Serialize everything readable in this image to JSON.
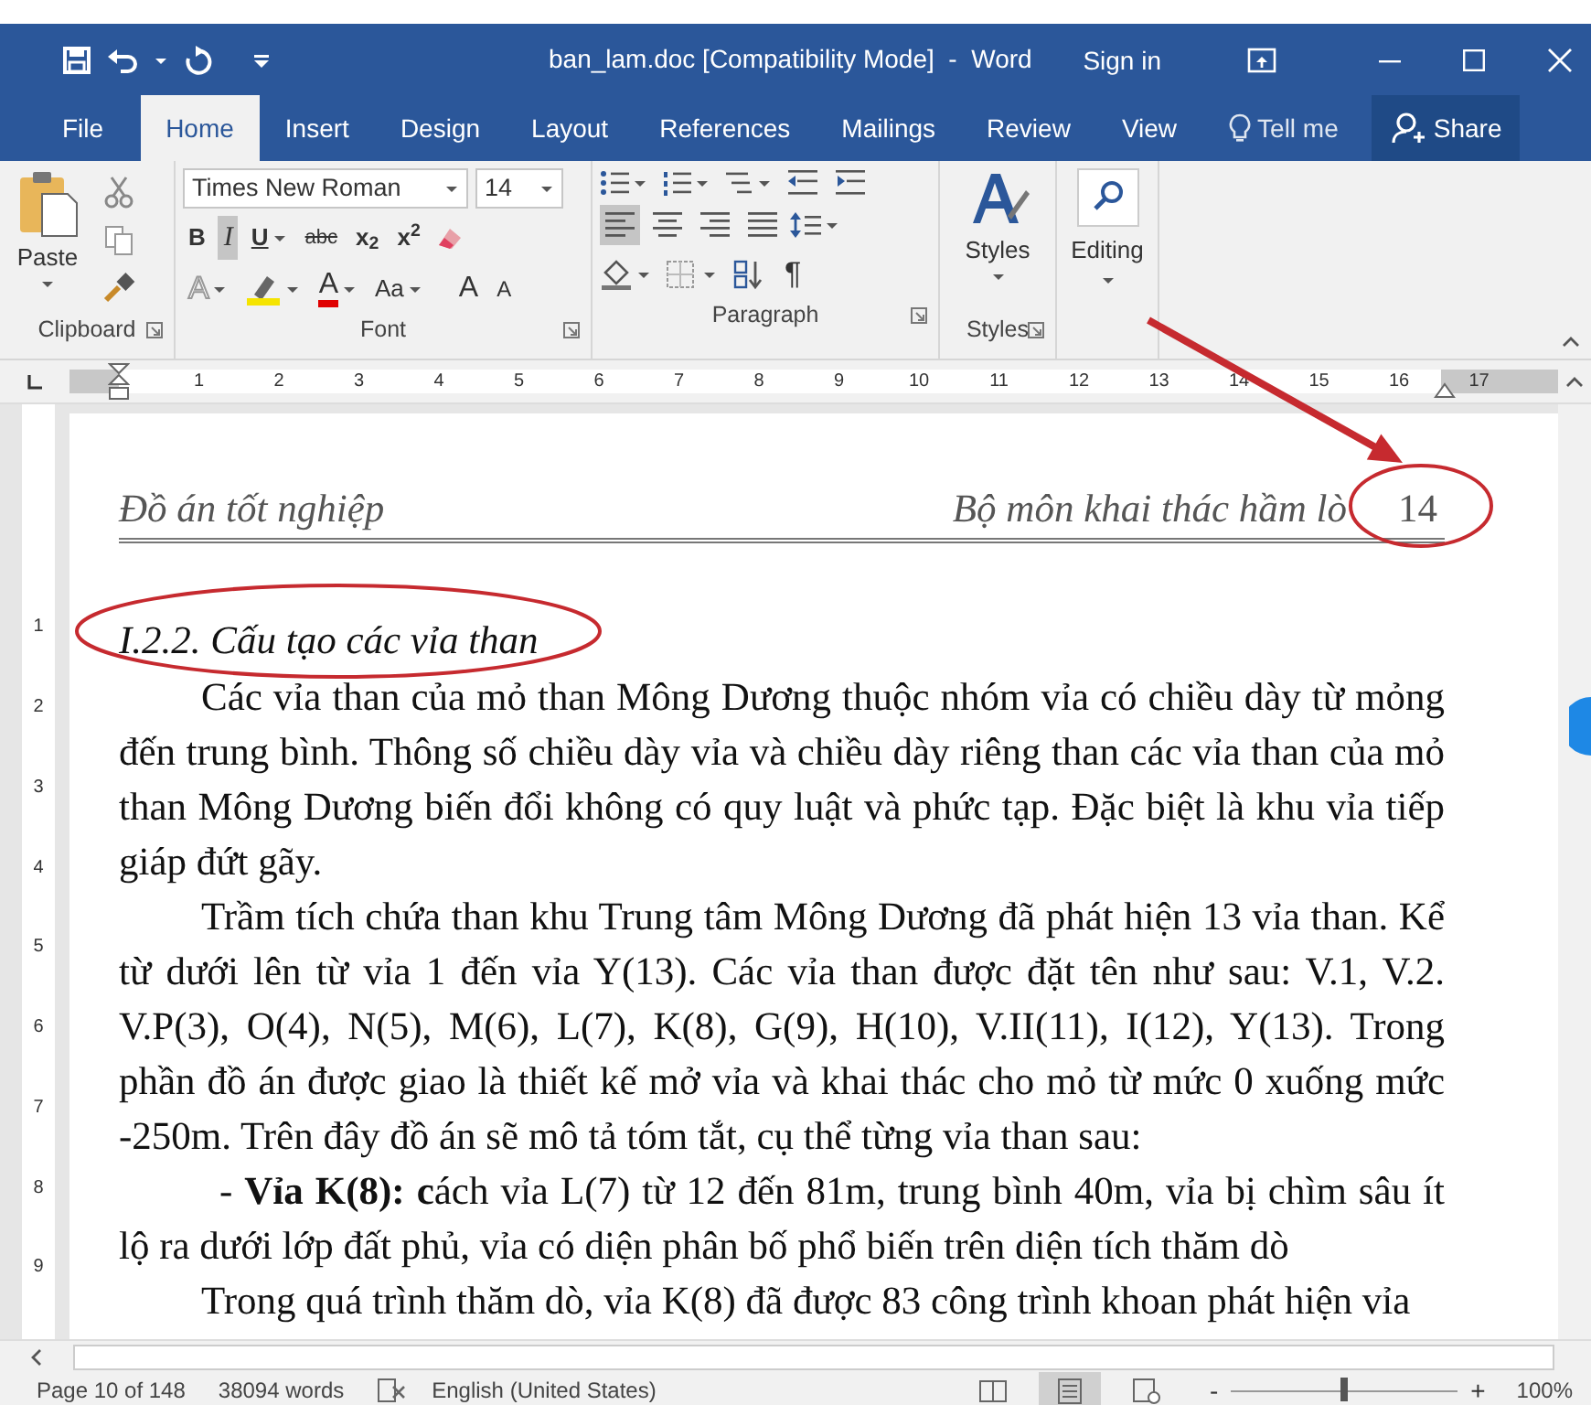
{
  "window": {
    "title": "ban_lam.doc [Compatibility Mode]  -  Word",
    "sign_in": "Sign in"
  },
  "tabs": [
    {
      "label": "File",
      "selected": false
    },
    {
      "label": "Home",
      "selected": true
    },
    {
      "label": "Insert",
      "selected": false
    },
    {
      "label": "Design",
      "selected": false
    },
    {
      "label": "Layout",
      "selected": false
    },
    {
      "label": "References",
      "selected": false
    },
    {
      "label": "Mailings",
      "selected": false
    },
    {
      "label": "Review",
      "selected": false
    },
    {
      "label": "View",
      "selected": false
    }
  ],
  "tell_me": "Tell me",
  "share": "Share",
  "clipboard": {
    "paste": "Paste",
    "label": "Clipboard"
  },
  "font": {
    "name": "Times New Roman",
    "size": "14",
    "styles": [
      {
        "label": "B",
        "kind": "bold",
        "on": false
      },
      {
        "label": "I",
        "kind": "italic",
        "on": true
      },
      {
        "label": "U",
        "kind": "underline",
        "on": false
      },
      {
        "label": "abc",
        "kind": "strike",
        "on": false
      },
      {
        "label": "x$_{2}$",
        "kind": "subscript",
        "on": false
      },
      {
        "label": "x$^{2}$",
        "kind": "superscript",
        "on": false
      }
    ],
    "text_effects": "A",
    "font_color": "A",
    "change_case": "Aa",
    "grow": "A",
    "shrink": "A",
    "label": "Font"
  },
  "paragraph": {
    "alignments": [
      {
        "kind": "left",
        "selected": true
      },
      {
        "kind": "center",
        "selected": false
      },
      {
        "kind": "right",
        "selected": false
      },
      {
        "kind": "justify",
        "selected": false
      }
    ],
    "show_marks": "¶",
    "label": "Paragraph"
  },
  "styles": {
    "button": "Styles",
    "label": "Styles"
  },
  "editing": {
    "button": "Editing"
  },
  "ruler": [
    "1",
    "2",
    "3",
    "4",
    "5",
    "6",
    "7",
    "8",
    "9",
    "10",
    "11",
    "12",
    "13",
    "14",
    "15",
    "16",
    "17"
  ],
  "vertical_ruler": [
    "1",
    "2",
    "3",
    "4",
    "5",
    "6",
    "7",
    "8",
    "9"
  ],
  "document": {
    "header": {
      "left": "Đồ án tốt nghiệp",
      "right": "Bộ môn khai thác hầm lò",
      "page_number": "14",
      "page_number_circled": true,
      "page_number_arrow": true
    },
    "heading": {
      "text": "I.2.2. Cấu tạo các vỉa than",
      "circled": true
    },
    "paragraphs": [
      {
        "kind": "indent",
        "text": "Các vỉa than của mỏ than Mông Dương thuộc nhóm vỉa có chiều dày từ mỏng đến trung bình. Thông số chiều dày vỉa và chiều dày riêng than các vỉa than của mỏ than Mông Dương biến đổi không có quy luật và phức tạp. Đặc biệt là khu vỉa tiếp giáp đứt gãy."
      },
      {
        "kind": "indent",
        "text": "Trầm tích chứa than khu Trung tâm Mông Dương đã phát hiện 13 vỉa than. Kể từ dưới lên từ vỉa 1 đến vỉa Y(13). Các vỉa than được đặt tên như sau: V.1, V.2. V.P(3), O(4), N(5), M(6), L(7), K(8), G(9), H(10), V.II(11), I(12), Y(13). Trong phần đồ án được giao là thiết kế mở vỉa và khai thác cho mỏ từ mức 0 xuống mức -250m. Trên đây đồ án sẽ mô tả tóm tắt, cụ thể từng vỉa than sau:"
      },
      {
        "kind": "item",
        "text": "- **Vỉa K(8): c**ách vỉa L(7) từ 12 đến 81m, trung bình 40m, vỉa bị chìm sâu ít lộ ra dưới lớp đất phủ, vỉa có diện phân bố phổ biến trên diện tích thăm dò"
      },
      {
        "kind": "indent",
        "text": "Trong quá trình thăm dò, vỉa K(8) đã được 83 công trình khoan phát hiện vỉa"
      }
    ]
  },
  "status_bar": {
    "page": "Page 10 of 148",
    "words": "38094 words",
    "language": "English (United States)",
    "views": [
      {
        "kind": "read",
        "selected": false
      },
      {
        "kind": "print",
        "selected": true
      },
      {
        "kind": "web",
        "selected": false
      }
    ],
    "zoom_out": "-",
    "zoom": {
      "level": 0.5
    },
    "zoom_in": "+",
    "zoom_text": "100%"
  }
}
